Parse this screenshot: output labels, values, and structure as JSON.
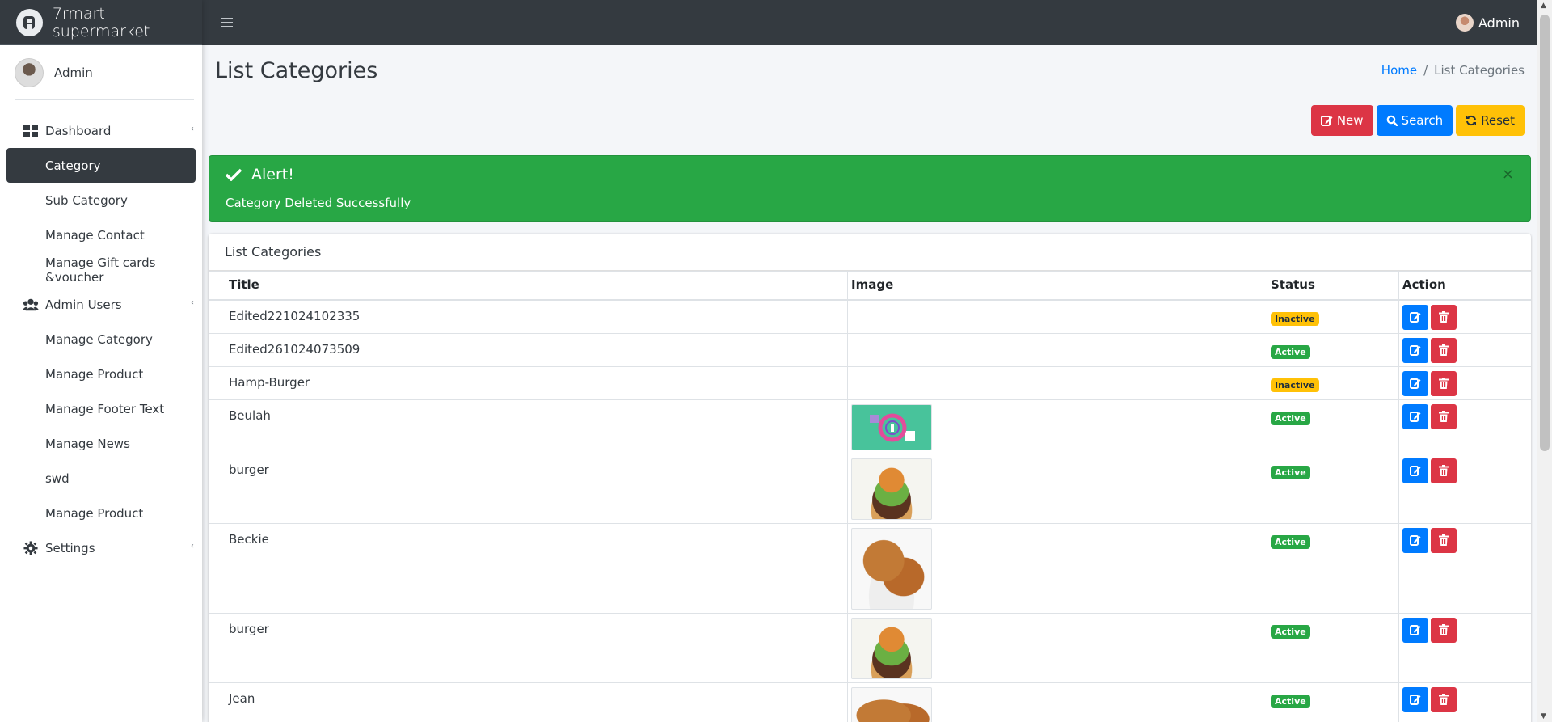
{
  "app": {
    "brand": "7rmart supermarket",
    "top_user": "Admin"
  },
  "sidebar": {
    "user": "Admin",
    "items": [
      {
        "label": "Dashboard",
        "icon": "dashboard-icon",
        "arrow": "‹"
      },
      {
        "label": "Category",
        "active": true
      },
      {
        "label": "Sub Category"
      },
      {
        "label": "Manage Contact"
      },
      {
        "label": "Manage Gift cards &voucher"
      },
      {
        "label": "Admin Users",
        "icon": "users-icon",
        "arrow": "‹"
      },
      {
        "label": "Manage Category"
      },
      {
        "label": "Manage Product"
      },
      {
        "label": "Manage Footer Text"
      },
      {
        "label": "Manage News"
      },
      {
        "label": "swd"
      },
      {
        "label": "Manage Product"
      },
      {
        "label": "Settings",
        "icon": "gear-icon",
        "arrow": "‹"
      }
    ]
  },
  "page": {
    "title": "List Categories",
    "breadcrumb": {
      "home": "Home",
      "current": "List Categories"
    }
  },
  "actions": {
    "new": "New",
    "search": "Search",
    "reset": "Reset"
  },
  "alert": {
    "title": "Alert!",
    "message": "Category Deleted Successfully",
    "close": "×"
  },
  "table": {
    "card_title": "List Categories",
    "columns": [
      "Title",
      "Image",
      "Status",
      "Action"
    ],
    "rows": [
      {
        "title": "Edited221024102335",
        "image": "",
        "status": "Inactive"
      },
      {
        "title": "Edited261024073509",
        "image": "",
        "status": "Active"
      },
      {
        "title": "Hamp-Burger",
        "image": "",
        "status": "Inactive"
      },
      {
        "title": "Beulah",
        "image": "logo",
        "status": "Active"
      },
      {
        "title": "burger",
        "image": "burger",
        "status": "Active"
      },
      {
        "title": "Beckie",
        "image": "chicken",
        "status": "Active"
      },
      {
        "title": "burger",
        "image": "burger",
        "status": "Active"
      },
      {
        "title": "Jean",
        "image": "chicken-partial",
        "status": "Active"
      }
    ]
  },
  "colors": {
    "topbar": "#343a40",
    "success": "#28a745",
    "danger": "#dc3545",
    "primary": "#007bff",
    "warning": "#ffc107"
  }
}
